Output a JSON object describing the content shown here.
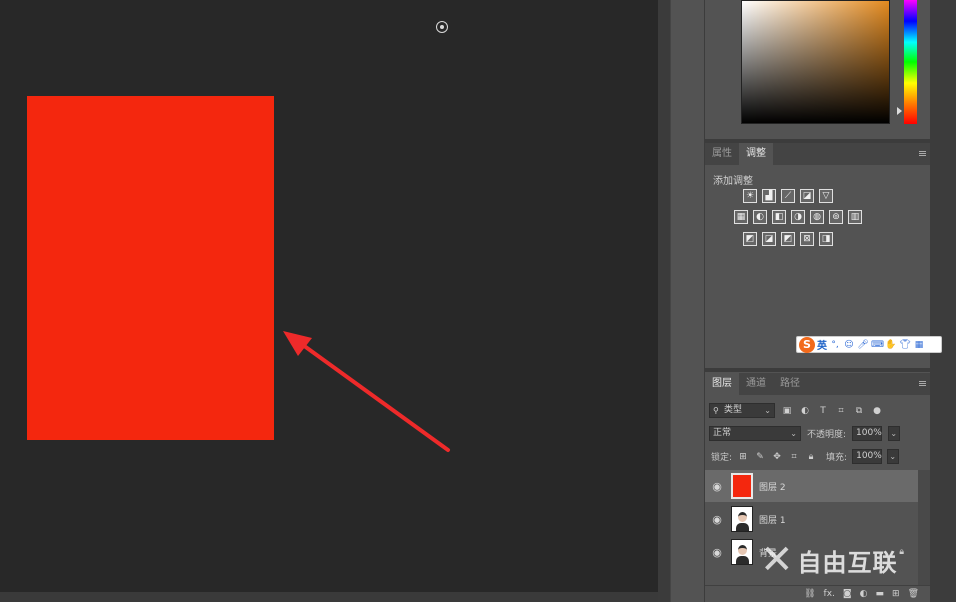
{
  "canvas": {
    "layer_color": "#f4270e"
  },
  "adjust_panel": {
    "tabs": [
      "属性",
      "调整"
    ],
    "active_tab": "调整",
    "title": "添加调整",
    "rows": [
      [
        "brightness-contrast-icon",
        "levels-icon",
        "curves-icon",
        "exposure-icon",
        "gradient-triangle-icon"
      ],
      [
        "vibrance-icon",
        "hue-saturation-icon",
        "color-balance-icon",
        "black-white-icon",
        "photo-filter-icon",
        "channel-mixer-icon",
        "color-lookup-icon"
      ],
      [
        "invert-icon",
        "posterize-icon",
        "threshold-icon",
        "selective-color-icon",
        "gradient-map-icon"
      ]
    ]
  },
  "ime": {
    "logo": "S",
    "lang": "英"
  },
  "layers_panel": {
    "tabs": [
      "图层",
      "通道",
      "路径"
    ],
    "active_tab": "图层",
    "filter_label": "类型",
    "blend_mode": "正常",
    "opacity_label": "不透明度:",
    "opacity_value": "100%",
    "lock_label": "锁定:",
    "fill_label": "填充:",
    "fill_value": "100%",
    "layers": [
      {
        "name": "图层 2",
        "thumb": "red",
        "selected": true
      },
      {
        "name": "图层 1",
        "thumb": "portrait",
        "selected": false
      },
      {
        "name": "背景",
        "thumb": "portrait",
        "selected": false
      }
    ]
  },
  "bottom_bar": {
    "fx_label": "fx."
  },
  "watermark": {
    "text": "自由互联"
  }
}
